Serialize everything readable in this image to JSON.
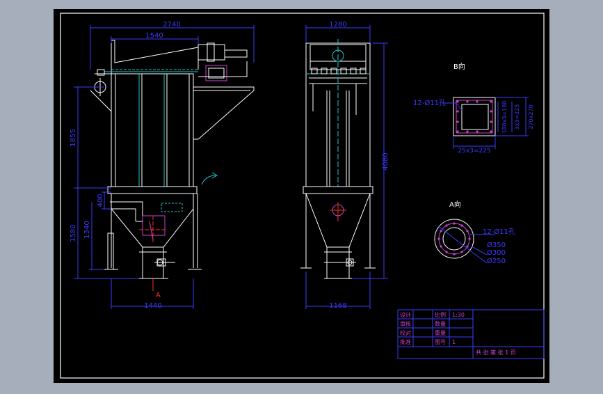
{
  "colors": {
    "desktop": "#a6aebb",
    "canvas": "#000000",
    "frame": "#ffffff",
    "dimension": "#3b3bff",
    "accent": "#d040d0",
    "cyan": "#20c8c8",
    "red": "#ff2b2b",
    "yellow": "#ffff33"
  },
  "front_view": {
    "dim_total_width": "2740",
    "dim_upper_width": "1540",
    "dim_upper_height": "1855",
    "dim_lower_height": "1580",
    "dim_inlet_height": "1340",
    "dim_inlet_size": "400",
    "dim_base_width": "1440",
    "section_label": "A"
  },
  "side_view": {
    "dim_top_width": "1280",
    "dim_total_height": "4080",
    "dim_base_width": "1168"
  },
  "flange_square": {
    "title": "B向",
    "hole_label": "12-Ø11孔",
    "dim_inner": "180x3=180",
    "dim_pitch": "3x3=225",
    "dim_outer": "270x270",
    "dim_bottom": "25x3=225"
  },
  "flange_round": {
    "title": "A向",
    "hole_label": "12-Ø11孔",
    "dia_outer": "Ø350",
    "dia_pitch": "Ø300",
    "dia_inner": "Ø250"
  },
  "title_block": {
    "rows": [
      [
        "设计",
        "比例",
        "1:30"
      ],
      [
        "审核",
        "数量",
        ""
      ],
      [
        "校对",
        "重量",
        ""
      ],
      [
        "批准",
        "图号",
        "1"
      ]
    ],
    "footer": "共 张 第 张 1 页"
  }
}
